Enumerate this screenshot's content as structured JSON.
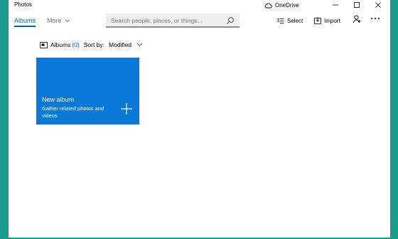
{
  "app": {
    "title": "Photos"
  },
  "titlebar": {
    "onedrive_label": "OneDrive"
  },
  "nav": {
    "tabs": [
      {
        "label": "Albums",
        "active": true
      },
      {
        "label": "More",
        "active": false
      }
    ]
  },
  "search": {
    "placeholder": "Search people, places, or things..."
  },
  "toolbar": {
    "select_label": "Select",
    "import_label": "Import"
  },
  "sortbar": {
    "albums_label": "Albums",
    "albums_count": "(0)",
    "sort_label": "Sort by:",
    "sort_value": "Modified"
  },
  "new_album": {
    "title": "New album",
    "description": "Gather related photos and videos"
  },
  "colors": {
    "accent": "#0063b1",
    "tile": "#0a78d7",
    "desktop": "#1a9a8a"
  },
  "icons": [
    "cloud-icon",
    "minimize-icon",
    "maximize-icon",
    "close-icon",
    "chevron-down-icon",
    "search-icon",
    "select-icon",
    "import-icon",
    "person-icon",
    "more-icon",
    "album-icon",
    "plus-icon"
  ]
}
